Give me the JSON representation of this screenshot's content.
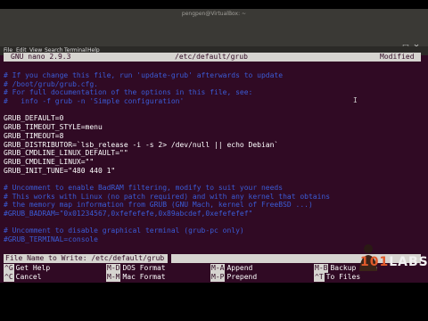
{
  "window": {
    "title": "pengpen@VirtualBox: ~"
  },
  "menubar": {
    "items": [
      "File",
      "Edit",
      "View",
      "Search",
      "Terminal",
      "Help"
    ]
  },
  "window_controls": {
    "minimize": "–",
    "maximize": "□",
    "close": "✕"
  },
  "nano": {
    "version": "GNU nano 2.9.3",
    "filename": "/etc/default/grub",
    "status": "Modified"
  },
  "editor_lines": [
    {
      "text": "# If you change this file, run 'update-grub' afterwards to update",
      "kind": "comment"
    },
    {
      "text": "# /boot/grub/grub.cfg.",
      "kind": "comment"
    },
    {
      "text": "# For full documentation of the options in this file, see:",
      "kind": "comment"
    },
    {
      "text": "#   info -f grub -n 'Simple configuration'",
      "kind": "comment"
    },
    {
      "text": "",
      "kind": "plain"
    },
    {
      "text": "GRUB_DEFAULT=0",
      "kind": "plain"
    },
    {
      "text": "GRUB_TIMEOUT_STYLE=menu",
      "kind": "plain"
    },
    {
      "text": "GRUB_TIMEOUT=8",
      "kind": "plain"
    },
    {
      "text": "GRUB_DISTRIBUTOR=`lsb_release -i -s 2> /dev/null || echo Debian`",
      "kind": "plain"
    },
    {
      "text": "GRUB_CMDLINE_LINUX_DEFAULT=\"\"",
      "kind": "plain"
    },
    {
      "text": "GRUB_CMDLINE_LINUX=\"\"",
      "kind": "plain"
    },
    {
      "text": "GRUB_INIT_TUNE=\"480 440 1\"",
      "kind": "plain"
    },
    {
      "text": "",
      "kind": "plain"
    },
    {
      "text": "# Uncomment to enable BadRAM filtering, modify to suit your needs",
      "kind": "comment"
    },
    {
      "text": "# This works with Linux (no patch required) and with any kernel that obtains",
      "kind": "comment"
    },
    {
      "text": "# the memory map information from GRUB (GNU Mach, kernel of FreeBSD ...)",
      "kind": "comment"
    },
    {
      "text": "#GRUB_BADRAM=\"0x01234567,0xfefefefe,0x89abcdef,0xefefefef\"",
      "kind": "comment"
    },
    {
      "text": "",
      "kind": "plain"
    },
    {
      "text": "# Uncomment to disable graphical terminal (grub-pc only)",
      "kind": "comment"
    },
    {
      "text": "#GRUB_TERMINAL=console",
      "kind": "comment"
    }
  ],
  "prompt": {
    "text": "File Name to Write: /etc/default/grub"
  },
  "shortcuts": [
    {
      "key": "^G",
      "label": "Get Help"
    },
    {
      "key": "M-D",
      "label": "DOS Format"
    },
    {
      "key": "M-A",
      "label": "Append"
    },
    {
      "key": "M-B",
      "label": "Backup File"
    },
    {
      "key": "^C",
      "label": "Cancel"
    },
    {
      "key": "M-M",
      "label": "Mac Format"
    },
    {
      "key": "M-P",
      "label": "Prepend"
    },
    {
      "key": "^T",
      "label": "To Files"
    }
  ],
  "logo": {
    "text_a": "101",
    "text_b": "LABS"
  },
  "colors": {
    "terminal_bg": "#300a24",
    "comment": "#3b5bd6",
    "header_bg": "#d6d4d0"
  }
}
